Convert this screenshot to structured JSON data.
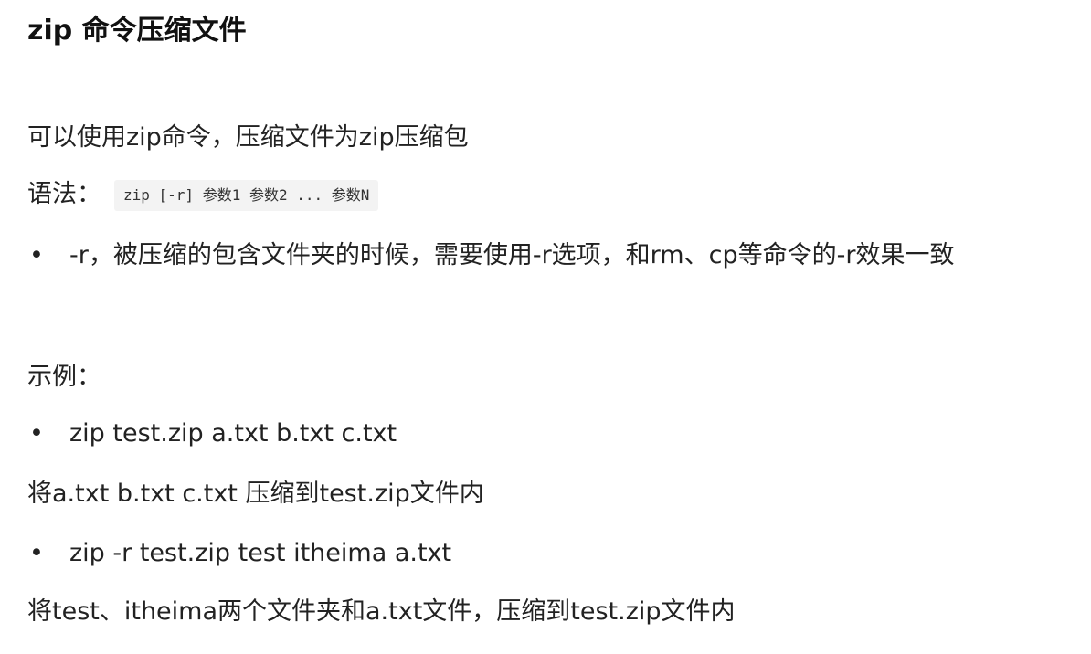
{
  "title": "zip 命令压缩文件",
  "intro": "可以使用zip命令，压缩文件为zip压缩包",
  "syntax": {
    "label": "语法：",
    "code": "zip [-r] 参数1 参数2 ... 参数N"
  },
  "options": [
    {
      "bullet": "•",
      "text": "-r，被压缩的包含文件夹的时候，需要使用-r选项，和rm、cp等命令的-r效果一致"
    }
  ],
  "examples_label": "示例：",
  "examples": [
    {
      "bullet": "•",
      "command": "zip test.zip a.txt b.txt c.txt",
      "description": "将a.txt b.txt c.txt 压缩到test.zip文件内"
    },
    {
      "bullet": "•",
      "command": "zip -r test.zip test itheima a.txt",
      "description": "将test、itheima两个文件夹和a.txt文件，压缩到test.zip文件内"
    }
  ]
}
